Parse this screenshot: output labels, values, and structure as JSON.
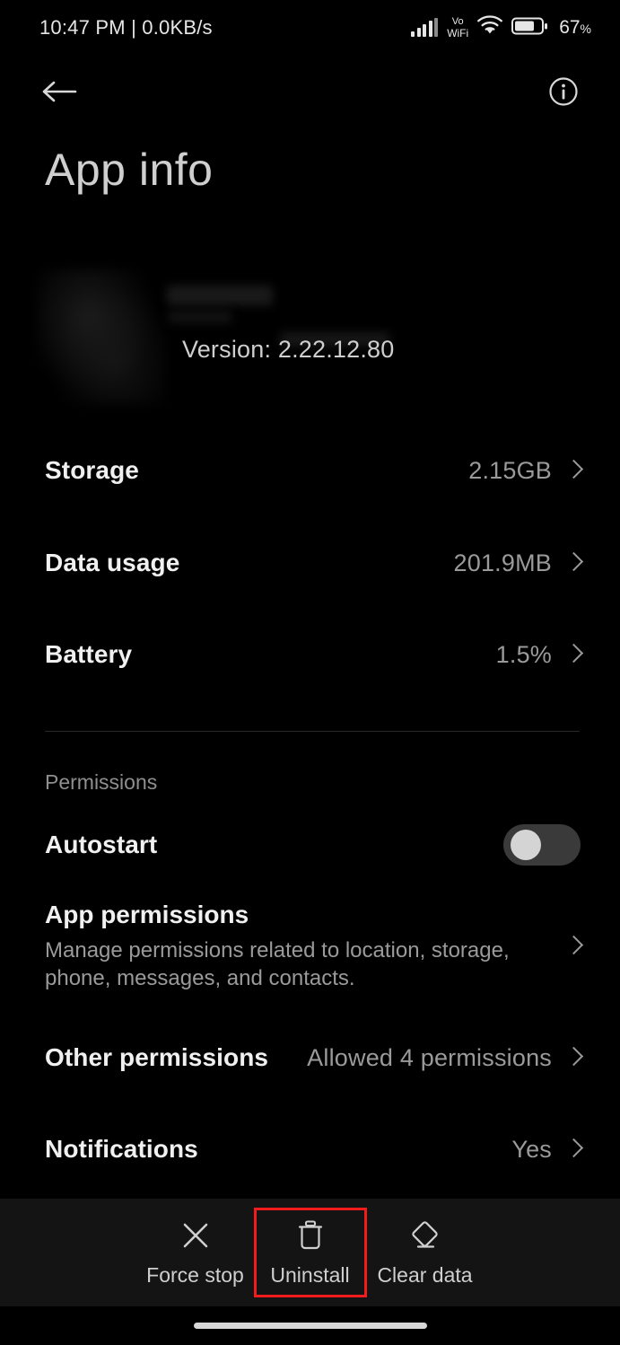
{
  "status_bar": {
    "time_and_speed": "10:47 PM | 0.0KB/s",
    "volte_line1": "Vo",
    "volte_line2": "WiFi",
    "battery_percent": "67",
    "battery_unit": "%",
    "signal_icon": "cellular-signal-icon",
    "wifi_icon": "wifi-icon",
    "battery_icon": "battery-icon"
  },
  "topbar": {
    "back_icon": "back-arrow-icon",
    "info_icon": "info-circle-icon"
  },
  "header": {
    "title": "App info"
  },
  "app": {
    "version": "Version: 2.22.12.80"
  },
  "list": {
    "storage": {
      "label": "Storage",
      "value": "2.15GB"
    },
    "data_usage": {
      "label": "Data usage",
      "value": "201.9MB"
    },
    "battery": {
      "label": "Battery",
      "value": "1.5%"
    }
  },
  "permissions": {
    "section_label": "Permissions",
    "autostart": {
      "label": "Autostart",
      "toggle_state": "off"
    },
    "app_permissions": {
      "label": "App permissions",
      "description": "Manage permissions related to location, storage, phone, messages, and contacts."
    },
    "other_permissions": {
      "label": "Other permissions",
      "value": "Allowed 4 permissions"
    },
    "notifications": {
      "label": "Notifications",
      "value": "Yes"
    }
  },
  "bottom_actions": {
    "force_stop": {
      "label": "Force stop",
      "icon": "close-x-icon"
    },
    "uninstall": {
      "label": "Uninstall",
      "icon": "trash-icon",
      "highlighted": true
    },
    "clear_data": {
      "label": "Clear data",
      "icon": "eraser-icon"
    }
  },
  "colors": {
    "background": "#000000",
    "bottom_bar": "#141414",
    "primary_text": "#f0f0f0",
    "secondary_text": "#9a9a9a",
    "highlight": "#f21c1c"
  }
}
